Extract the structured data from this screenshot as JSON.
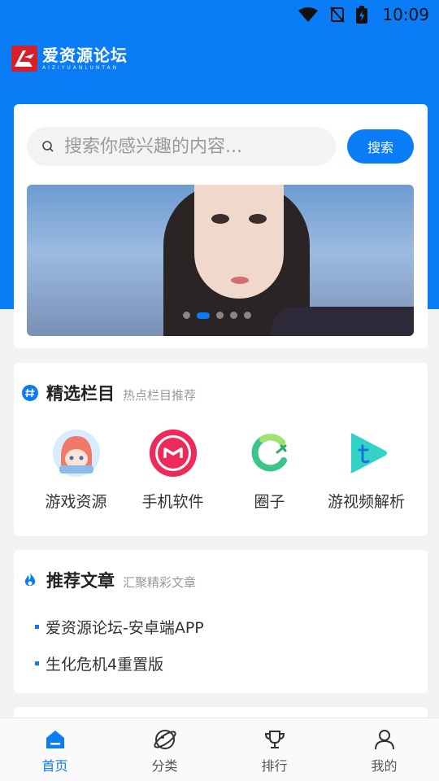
{
  "status_bar": {
    "time": "10:09"
  },
  "header": {
    "logo_text": "爱资源论坛",
    "logo_subtext": "AIZIYUANLUNTAN"
  },
  "search": {
    "placeholder": "搜索你感兴趣的内容...",
    "button_label": "搜索"
  },
  "banner": {
    "slide_count": 5,
    "active_index": 1
  },
  "featured": {
    "title": "精选栏目",
    "subtitle": "热点栏目推荐",
    "items": [
      {
        "label": "游戏资源",
        "icon": "anime-avatar-icon"
      },
      {
        "label": "手机软件",
        "icon": "pink-app-icon"
      },
      {
        "label": "圈子",
        "icon": "circle-swirl-icon"
      },
      {
        "label": "游视频解析",
        "icon": "video-play-icon"
      }
    ]
  },
  "articles": {
    "title": "推荐文章",
    "subtitle": "汇聚精彩文章",
    "items": [
      {
        "title": "爱资源论坛-安卓端APP"
      },
      {
        "title": "生化危机4重置版"
      }
    ]
  },
  "tabbar": {
    "items": [
      {
        "label": "首页",
        "icon": "home-icon",
        "active": true
      },
      {
        "label": "分类",
        "icon": "planet-icon",
        "active": false
      },
      {
        "label": "排行",
        "icon": "trophy-icon",
        "active": false
      },
      {
        "label": "我的",
        "icon": "user-icon",
        "active": false
      }
    ]
  },
  "colors": {
    "primary": "#0a7cf5",
    "logo_red": "#d5202a",
    "page_bg": "#f2f2f4"
  }
}
